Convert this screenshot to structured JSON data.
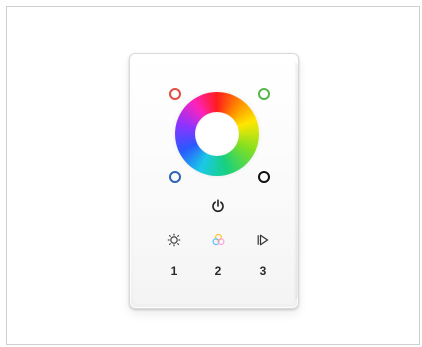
{
  "product_photo": {
    "background": "#ffffff",
    "panel_color": "#fafafa",
    "wheel_colors": [
      "#ff1c1c",
      "#ff8a00",
      "#ffe700",
      "#82df22",
      "#17d07f",
      "#1bc9e7",
      "#2a57ff",
      "#8d33ff",
      "#ff23ba"
    ],
    "ring_indicators": {
      "top_left_color": "#e04b42",
      "top_right_color": "#55b84a",
      "bottom_left_color": "#2e63b9",
      "bottom_right_color": "#111111"
    },
    "icons": {
      "power": "power-icon",
      "brightness": "sun-icon",
      "color_mix": "rgb-circles-icon",
      "mode": "play-icon"
    },
    "scene_labels": [
      "1",
      "2",
      "3"
    ]
  }
}
